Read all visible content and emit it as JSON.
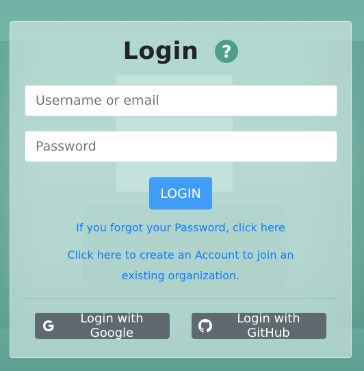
{
  "login": {
    "title": "Login",
    "help_symbol": "?",
    "username_placeholder": "Username or email",
    "password_placeholder": "Password",
    "submit_label": "LOGIN",
    "forgot_link": "If you forgot your Password, click here",
    "create_link": "Click here to create an Account to join an existing organization.",
    "google_label": "Login with Google",
    "github_label": "Login with GitHub"
  },
  "icons": {
    "help": "question-circle-icon",
    "google": "google-icon",
    "github": "github-icon"
  },
  "colors": {
    "primary": "#3f9cf7",
    "link": "#0d7bff",
    "help_icon": "#4e9e8b",
    "social_button": "#5f6a70"
  }
}
